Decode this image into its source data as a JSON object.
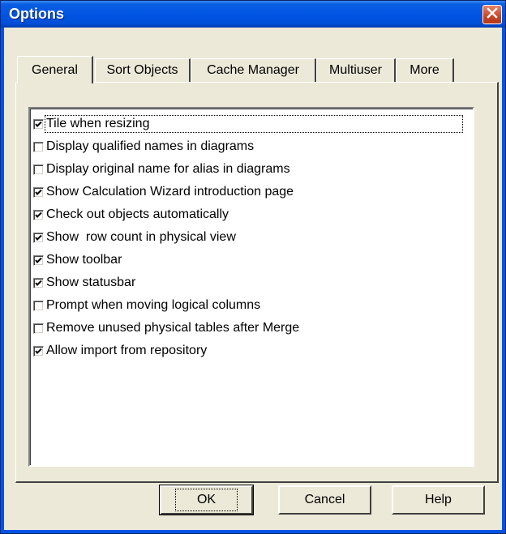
{
  "window": {
    "title": "Options"
  },
  "tabs": [
    {
      "label": "General",
      "active": true
    },
    {
      "label": "Sort Objects",
      "active": false
    },
    {
      "label": "Cache Manager",
      "active": false
    },
    {
      "label": "Multiuser",
      "active": false
    },
    {
      "label": "More",
      "active": false
    }
  ],
  "options": [
    {
      "label": "Tile when resizing",
      "checked": true
    },
    {
      "label": "Display qualified names in diagrams",
      "checked": false
    },
    {
      "label": "Display original name for alias in diagrams",
      "checked": false
    },
    {
      "label": "Show Calculation Wizard introduction page",
      "checked": true
    },
    {
      "label": "Check out objects automatically",
      "checked": true
    },
    {
      "label": "Show  row count in physical view",
      "checked": true
    },
    {
      "label": "Show toolbar",
      "checked": true
    },
    {
      "label": "Show statusbar",
      "checked": true
    },
    {
      "label": "Prompt when moving logical columns",
      "checked": false
    },
    {
      "label": "Remove unused physical tables after Merge",
      "checked": false
    },
    {
      "label": "Allow import from repository",
      "checked": true
    }
  ],
  "buttons": {
    "ok": "OK",
    "cancel": "Cancel",
    "help": "Help"
  },
  "icons": {
    "close": "close-icon",
    "checkmark": "checkmark-icon"
  }
}
